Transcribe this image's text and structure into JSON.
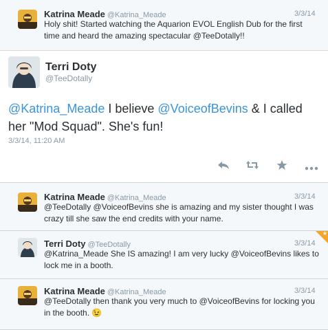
{
  "tweets": [
    {
      "name": "Katrina Meade",
      "handle": "@Katrina_Meade",
      "date": "3/3/14",
      "text": "Holy shit! Started watching the Aquarion EVOL English Dub for the first time and heard the amazing spectacular @TeeDotally!!"
    },
    {
      "name": "Katrina Meade",
      "handle": "@Katrina_Meade",
      "date": "3/3/14",
      "text": "@TeeDotally @VoiceofBevins she is amazing and my sister thought I was crazy till she saw the end credits with your name."
    },
    {
      "name": "Terri Doty",
      "handle": "@TeeDotally",
      "date": "3/3/14",
      "text": "@Katrina_Meade She IS amazing! I am very lucky @VoiceofBevins likes to lock me in a booth."
    },
    {
      "name": "Katrina Meade",
      "handle": "@Katrina_Meade",
      "date": "3/3/14",
      "text": "@TeeDotally then thank you very much to @VoiceofBevins for locking you in the booth. 😉"
    }
  ],
  "main": {
    "name": "Terri Doty",
    "handle": "@TeeDotally",
    "mention1": "@Katrina_Meade",
    "text1": " I believe ",
    "mention2": "@VoiceofBevins",
    "text2": " & I called her \"Mod Squad\". She's fun!",
    "timestamp": "3/3/14, 11:20 AM"
  },
  "actions": {
    "reply": "reply-icon",
    "retweet": "retweet-icon",
    "favorite": "star-icon",
    "more": "more-icon"
  },
  "colors": {
    "accent": "#3b94d9",
    "favorite_flag": "#f4a62a"
  }
}
